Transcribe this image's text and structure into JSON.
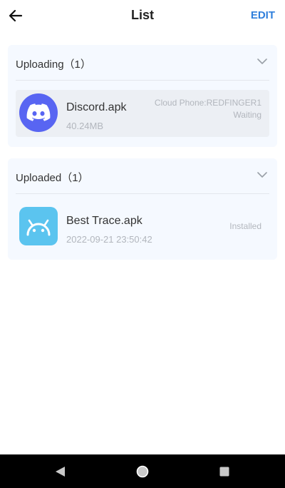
{
  "header": {
    "title": "List",
    "edit_label": "EDIT",
    "back_icon": "arrow-left-icon"
  },
  "uploading": {
    "title": "Uploading（1）",
    "items": [
      {
        "name": "Discord.apk",
        "size": "40.24MB",
        "target": "Cloud Phone:REDFINGER1",
        "status": "Waiting",
        "icon": "discord-app-icon",
        "icon_color": "#5865f2"
      }
    ]
  },
  "uploaded": {
    "title": "Uploaded（1）",
    "items": [
      {
        "name": "Best Trace.apk",
        "date": "2022-09-21 23:50:42",
        "status": "Installed",
        "icon": "android-app-icon",
        "icon_color": "#5bc4ef"
      }
    ]
  },
  "colors": {
    "accent": "#2f7fdc",
    "section_bg": "#f5f9ff",
    "muted_text": "#b2b6bd"
  },
  "nav": {
    "back_icon": "triangle-back-icon",
    "home_icon": "circle-home-icon",
    "recents_icon": "square-recents-icon"
  }
}
